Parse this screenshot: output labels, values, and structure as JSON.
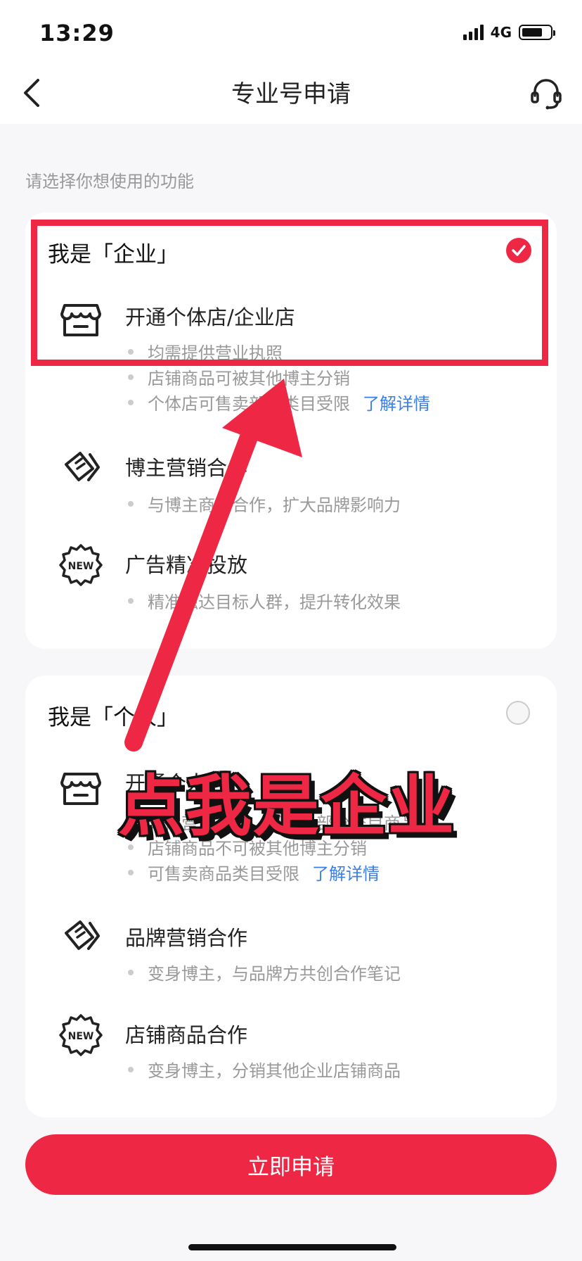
{
  "status_bar": {
    "time": "13:29",
    "network": "4G"
  },
  "nav": {
    "title": "专业号申请"
  },
  "hint": "请选择你想使用的功能",
  "enterprise": {
    "heading": "我是「企业」",
    "selected": true,
    "items": [
      {
        "icon": "store-icon",
        "title": "开通个体店/企业店",
        "descs": [
          "均需提供营业执照",
          "店铺商品可被其他博主分销",
          "个体店可售卖部分类目受限"
        ],
        "link": "了解详情"
      },
      {
        "icon": "document-icon",
        "title": "博主营销合作",
        "descs": [
          "与博主商业合作，扩大品牌影响力"
        ]
      },
      {
        "icon": "new-badge-icon",
        "title": "广告精准投放",
        "descs": [
          "精准触达目标人群，提升转化效果"
        ]
      }
    ]
  },
  "personal": {
    "heading": "我是「个人」",
    "selected": false,
    "items": [
      {
        "icon": "store-icon",
        "title": "开通个人店",
        "descs": [
          "无需营业执照，可售卖部分类目商品",
          "店铺商品不可被其他博主分销",
          "可售卖商品类目受限"
        ],
        "link": "了解详情"
      },
      {
        "icon": "document-icon",
        "title": "品牌营销合作",
        "descs": [
          "变身博主，与品牌方共创合作笔记"
        ]
      },
      {
        "icon": "new-badge-icon",
        "title": "店铺商品合作",
        "descs": [
          "变身博主，分销其他企业店铺商品"
        ]
      }
    ]
  },
  "apply_button": "立即申请",
  "overlay": {
    "text": "点我是企业"
  },
  "colors": {
    "accent": "#ee2844",
    "link": "#3a7ee8"
  }
}
